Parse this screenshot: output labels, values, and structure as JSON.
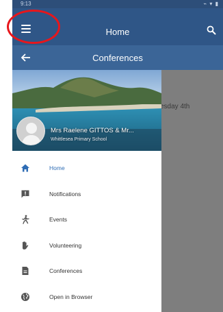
{
  "statusbar": {
    "time": "9:13",
    "icons": "⌁ ▾ ▮"
  },
  "topbar": {
    "title": "Home"
  },
  "subbar": {
    "title": "Conferences"
  },
  "background": {
    "text": "esday 4th"
  },
  "drawer": {
    "user_name": "Mrs Raelene GITTOS & Mr...",
    "school": "Whittlesea Primary School",
    "items": [
      {
        "label": "Home",
        "icon": "home-icon",
        "active": true
      },
      {
        "label": "Notifications",
        "icon": "notification-icon"
      },
      {
        "label": "Events",
        "icon": "events-icon"
      },
      {
        "label": "Volunteering",
        "icon": "volunteering-icon"
      },
      {
        "label": "Conferences",
        "icon": "conferences-icon"
      },
      {
        "label": "Open in Browser",
        "icon": "globe-icon"
      }
    ]
  },
  "colors": {
    "topbar": "#2f5687",
    "subbar": "#3b6597",
    "active": "#2f6db5",
    "highlight": "#e8161b"
  }
}
